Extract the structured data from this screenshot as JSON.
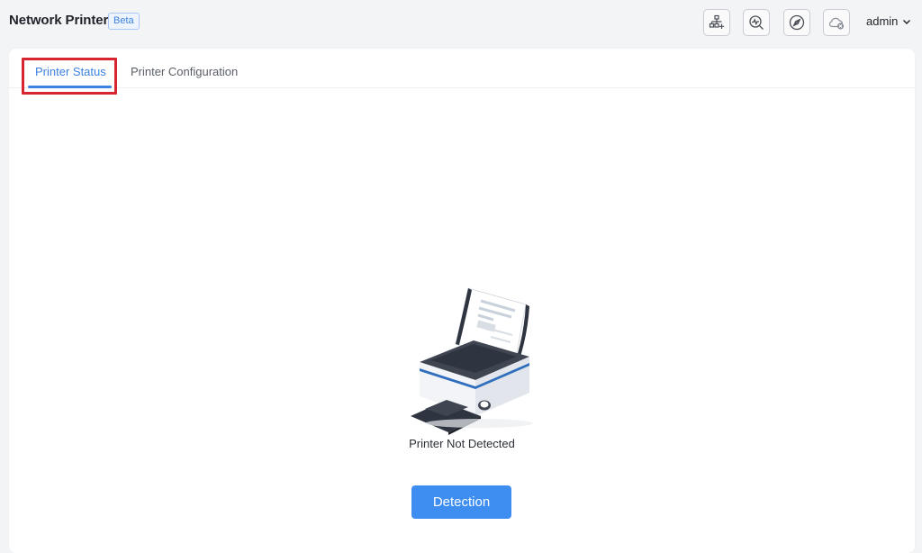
{
  "header": {
    "app_title": "Network Printer",
    "badge": "Beta",
    "icons": [
      "network-add-icon",
      "diagnostic-icon",
      "compass-icon",
      "cloud-disconnected-icon"
    ],
    "user": "admin"
  },
  "tabs": [
    {
      "label": "Printer Status",
      "active": true
    },
    {
      "label": "Printer Configuration",
      "active": false
    }
  ],
  "main": {
    "status_text": "Printer Not Detected",
    "action_label": "Detection"
  },
  "colors": {
    "accent": "#3d82e0",
    "button": "#3d8ef0",
    "highlight": "#d7262f"
  }
}
